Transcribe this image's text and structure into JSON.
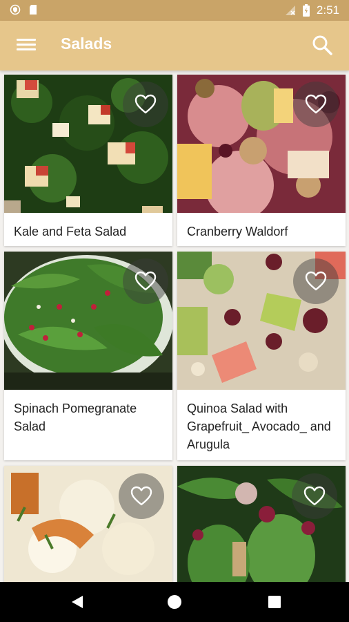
{
  "status_bar": {
    "time": "2:51",
    "left_icons": [
      "shield-icon",
      "sd-card-icon"
    ],
    "right_icons": [
      "no-signal-icon",
      "battery-icon"
    ]
  },
  "app_bar": {
    "title": "Salads",
    "background_color": "#e6c68b",
    "status_color": "#c9a468",
    "menu_icon": "hamburger-menu-icon",
    "search_icon": "search-icon"
  },
  "recipes": [
    {
      "title": "Kale and Feta Salad",
      "favorite_icon": "heart-outline-icon"
    },
    {
      "title": "Cranberry Waldorf",
      "favorite_icon": "heart-outline-icon"
    },
    {
      "title": "Spinach Pomegranate Salad",
      "favorite_icon": "heart-outline-icon"
    },
    {
      "title": "Quinoa Salad with Grapefruit_ Avocado_ and Arugula",
      "favorite_icon": "heart-outline-icon"
    },
    {
      "title": "",
      "favorite_icon": "heart-outline-icon"
    },
    {
      "title": "",
      "favorite_icon": "heart-outline-icon"
    }
  ],
  "nav_bar": {
    "buttons": [
      "back-icon",
      "home-icon",
      "recents-icon"
    ]
  }
}
